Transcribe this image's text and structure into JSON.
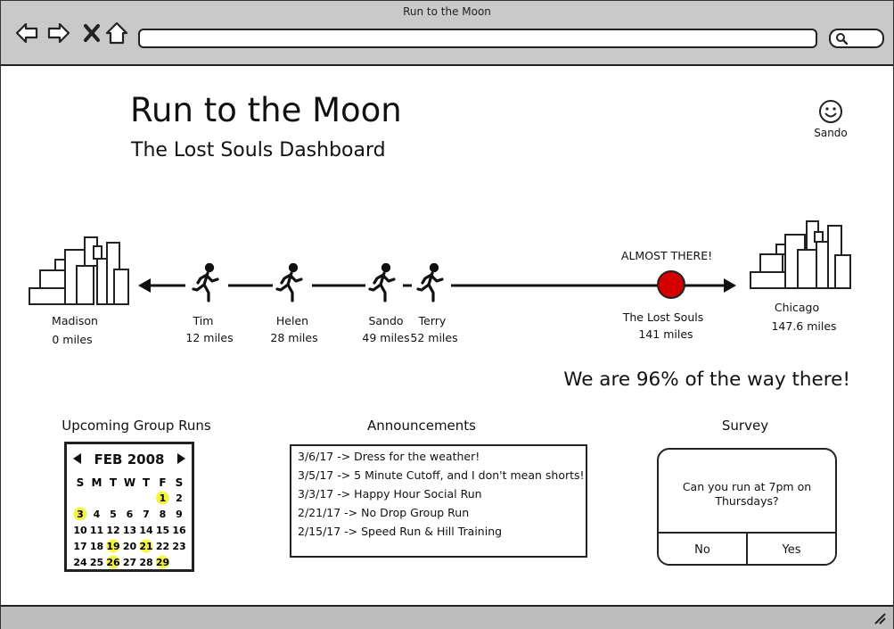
{
  "window": {
    "title": "Run to the Moon"
  },
  "browser": {
    "nav_icons": [
      "back-arrow-icon",
      "forward-arrow-icon",
      "close-icon",
      "home-icon",
      "search-icon"
    ]
  },
  "header": {
    "title": "Run to the Moon",
    "subtitle": "The Lost Souls Dashboard"
  },
  "user": {
    "name": "Sando",
    "icon": "smiley-face-icon"
  },
  "track": {
    "start": {
      "city": "Madison",
      "miles": "0 miles"
    },
    "end": {
      "city": "Chicago",
      "miles": "147.6 miles"
    },
    "runners": [
      {
        "name": "Tim",
        "miles": "12 miles"
      },
      {
        "name": "Helen",
        "miles": "28 miles"
      },
      {
        "name": "Sando",
        "miles": "49 miles"
      },
      {
        "name": "Terry",
        "miles": "52 miles"
      }
    ],
    "team": {
      "callout": "ALMOST THERE!",
      "name": "The Lost Souls",
      "miles": "141 miles",
      "marker_color": "#d40000"
    }
  },
  "progress": {
    "text": "We are 96% of the way there!",
    "percent": 96
  },
  "group_runs": {
    "title": "Upcoming Group Runs",
    "calendar": {
      "month": "FEB 2008",
      "weekdays": [
        "S",
        "M",
        "T",
        "W",
        "T",
        "F",
        "S"
      ],
      "weeks": [
        [
          "",
          "",
          "",
          "",
          "",
          "1",
          "2"
        ],
        [
          "3",
          "4",
          "5",
          "6",
          "7",
          "8",
          "9"
        ],
        [
          "10",
          "11",
          "12",
          "13",
          "14",
          "15",
          "16"
        ],
        [
          "17",
          "18",
          "19",
          "20",
          "21",
          "22",
          "23"
        ],
        [
          "24",
          "25",
          "26",
          "27",
          "28",
          "29",
          ""
        ]
      ],
      "highlighted": [
        "1",
        "3",
        "19",
        "21",
        "26",
        "29"
      ],
      "highlight_color": "#f2f224"
    }
  },
  "announcements": {
    "title": "Announcements",
    "items": [
      "3/6/17 -> Dress for the weather!",
      "3/5/17 -> 5 Minute Cutoff, and I don't mean shorts!",
      "3/3/17 -> Happy Hour Social Run",
      "2/21/17 -> No Drop Group Run",
      "2/15/17 -> Speed Run & Hill Training"
    ]
  },
  "survey": {
    "title": "Survey",
    "question": "Can you run at 7pm on Thursdays?",
    "no_label": "No",
    "yes_label": "Yes"
  }
}
